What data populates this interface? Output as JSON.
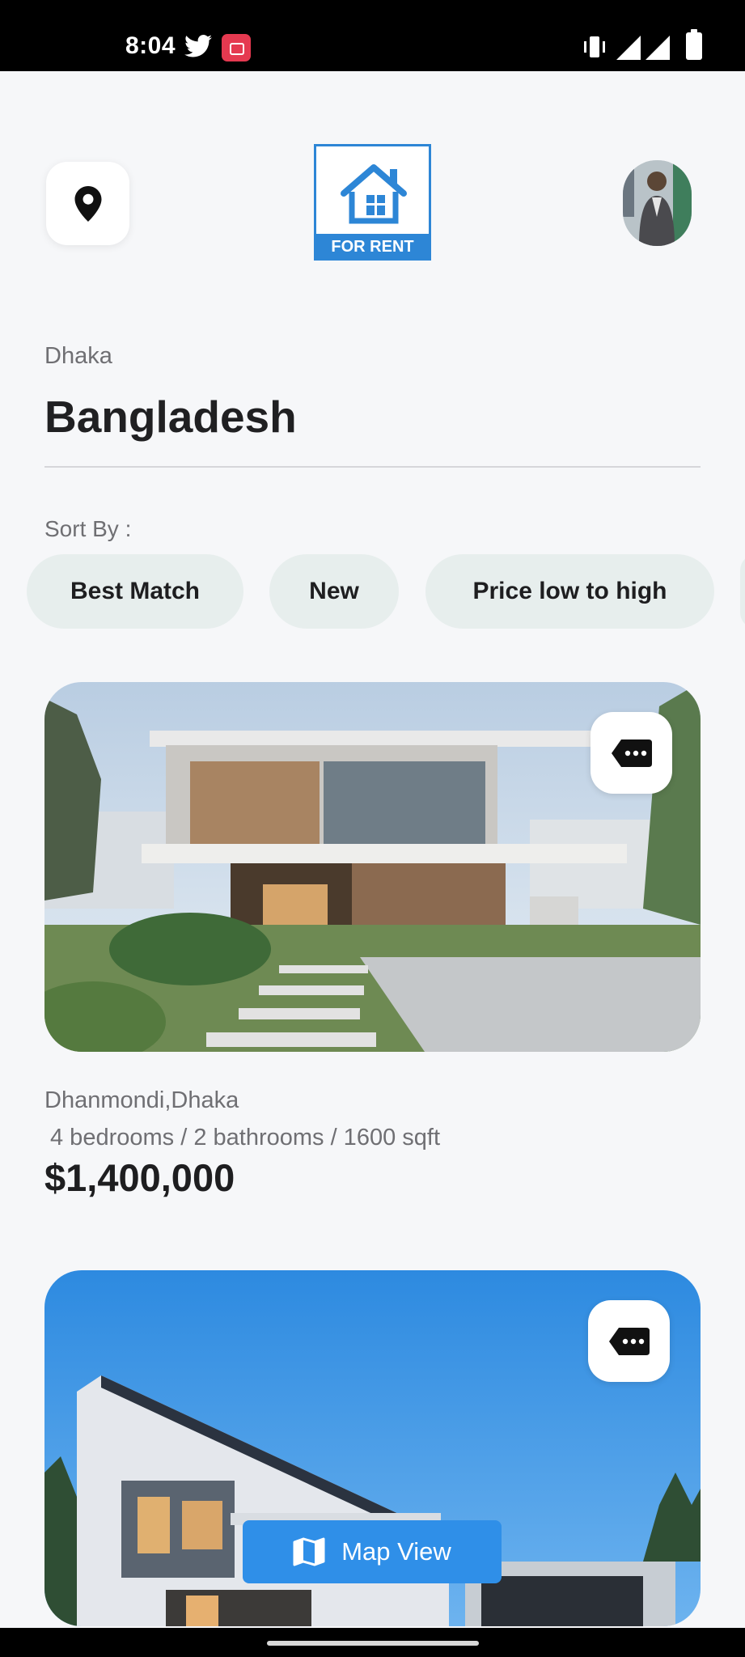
{
  "status_bar": {
    "time": "8:04",
    "icons": [
      "twitter-icon",
      "screen-record-icon",
      "vibrate-icon",
      "signal-icon",
      "signal-icon",
      "battery-icon"
    ]
  },
  "header": {
    "location_icon": "map-pin-icon",
    "logo_text": "FOR RENT",
    "brand_color": "#2d86d6"
  },
  "location": {
    "city": "Dhaka",
    "country": "Bangladesh"
  },
  "sort": {
    "label": "Sort By :",
    "options": [
      "Best Match",
      "New",
      "Price low to high"
    ]
  },
  "listings": [
    {
      "area": "Dhanmondi,Dhaka",
      "specs": "4 bedrooms / 2 bathrooms / 1600 sqft",
      "price": "$1,400,000"
    }
  ],
  "map_button": {
    "label": "Map View",
    "color": "#2f8fe8"
  }
}
